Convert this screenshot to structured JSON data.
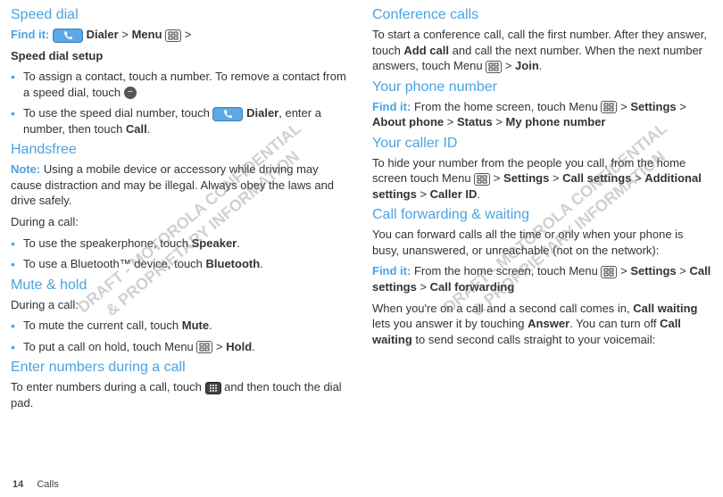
{
  "left": {
    "speed_dial": {
      "heading": "Speed dial",
      "find_label": "Find it:",
      "dialer": "Dialer",
      "menu": "Menu",
      "setup": "Speed dial setup",
      "b1_a": "To assign a contact, touch a number. To remove a contact from a speed dial, touch ",
      "b2_a": "To use the speed dial number, touch ",
      "b2_b": "Dialer",
      "b2_c": ", enter a number, then touch ",
      "b2_d": "Call",
      "b2_e": "."
    },
    "handsfree": {
      "heading": "Handsfree",
      "note_label": "Note:",
      "note_text": " Using a mobile device or accessory while driving may cause distraction and may be illegal. Always obey the laws and drive safely.",
      "during": "During a call:",
      "b1_a": "To use the speakerphone, touch ",
      "b1_b": "Speaker",
      "b1_c": ".",
      "b2_a": "To use a Bluetooth™ device, touch ",
      "b2_b": "Bluetooth",
      "b2_c": "."
    },
    "mute": {
      "heading": "Mute & hold",
      "during": "During a call:",
      "b1_a": "To mute the current call, touch ",
      "b1_b": "Mute",
      "b1_c": ".",
      "b2_a": "To put a call on hold, touch Menu ",
      "b2_b": " > ",
      "b2_c": "Hold",
      "b2_d": "."
    },
    "enter": {
      "heading": "Enter numbers during a call",
      "p_a": "To enter numbers during a call, touch ",
      "p_b": " and then touch the dial pad."
    }
  },
  "right": {
    "conf": {
      "heading": "Conference calls",
      "p_a": "To start a conference call, call the first number. After they answer, touch ",
      "p_b": "Add call",
      "p_c": " and call the next number. When the next number answers, touch Menu ",
      "p_d": " > ",
      "p_e": "Join",
      "p_f": "."
    },
    "phone_num": {
      "heading": "Your phone number",
      "find_label": "Find it:",
      "p_a": " From the home screen, touch Menu ",
      "p_b": " > ",
      "p_c": "Settings",
      "p_d": " > ",
      "p_e": "About phone",
      "p_f": " > ",
      "p_g": "Status",
      "p_h": " > ",
      "p_i": "My phone number"
    },
    "caller_id": {
      "heading": "Your caller ID",
      "p_a": "To hide your number from the people you call, from the home screen touch Menu ",
      "p_b": " > ",
      "p_c": "Settings",
      "p_d": " > ",
      "p_e": "Call settings",
      "p_f": " > ",
      "p_g": "Additional settings",
      "p_h": " > ",
      "p_i": "Caller ID",
      "p_j": "."
    },
    "fwd": {
      "heading": "Call forwarding & waiting",
      "p1": "You can forward calls all the time or only when your phone is busy, unanswered, or unreachable (not on the network):",
      "find_label": "Find it:",
      "p2_a": " From the home screen, touch Menu ",
      "p2_b": " > ",
      "p2_c": "Settings",
      "p2_d": " > ",
      "p2_e": "Call settings",
      "p2_f": " > ",
      "p2_g": "Call forwarding",
      "p3_a": "When you're on a call and a second call comes in, ",
      "p3_b": "Call waiting",
      "p3_c": " lets you answer it by touching ",
      "p3_d": "Answer",
      "p3_e": ". You can turn off ",
      "p3_f": "Call waiting",
      "p3_g": " to send second calls straight to your voicemail:"
    }
  },
  "footer": {
    "page": "14",
    "section": "Calls"
  },
  "watermark": "DRAFT - MOTOROLA CONFIDENTIAL\n& PROPRIETARY INFORMATION",
  "icons": {
    "phone": "phone-icon",
    "menu": "menu-icon",
    "minus": "remove-icon",
    "keypad": "keypad-icon"
  }
}
